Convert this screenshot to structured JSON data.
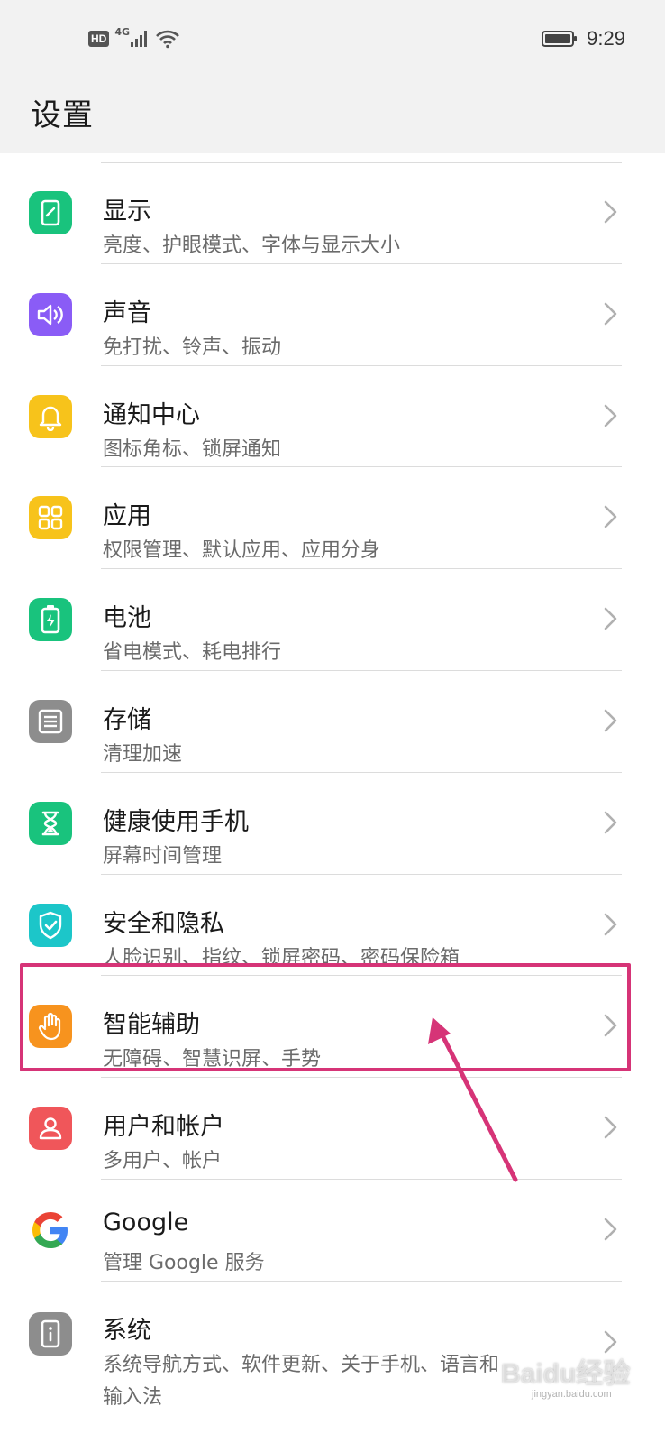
{
  "status_bar": {
    "hd_label": "HD",
    "network_label": "4G",
    "time": "9:29"
  },
  "header": {
    "title": "设置"
  },
  "settings": [
    {
      "title": "显示",
      "subtitle": "亮度、护眼模式、字体与显示大小",
      "icon": "display-icon",
      "color": "#19c37d"
    },
    {
      "title": "声音",
      "subtitle": "免打扰、铃声、振动",
      "icon": "speaker-icon",
      "color": "#8a5cf6"
    },
    {
      "title": "通知中心",
      "subtitle": "图标角标、锁屏通知",
      "icon": "bell-icon",
      "color": "#f7c31b"
    },
    {
      "title": "应用",
      "subtitle": "权限管理、默认应用、应用分身",
      "icon": "apps-grid-icon",
      "color": "#f7c31b"
    },
    {
      "title": "电池",
      "subtitle": "省电模式、耗电排行",
      "icon": "battery-icon",
      "color": "#19c37d"
    },
    {
      "title": "存储",
      "subtitle": "清理加速",
      "icon": "storage-icon",
      "color": "#8d8d8d"
    },
    {
      "title": "健康使用手机",
      "subtitle": "屏幕时间管理",
      "icon": "hourglass-icon",
      "color": "#19c37d"
    },
    {
      "title": "安全和隐私",
      "subtitle": "人脸识别、指纹、锁屏密码、密码保险箱",
      "icon": "shield-icon",
      "color": "#1cc6c9"
    },
    {
      "title": "智能辅助",
      "subtitle": "无障碍、智慧识屏、手势",
      "icon": "hand-icon",
      "color": "#f7931e"
    },
    {
      "title": "用户和帐户",
      "subtitle": "多用户、帐户",
      "icon": "user-icon",
      "color": "#f0565a"
    },
    {
      "title": "Google",
      "subtitle": "管理 Google 服务",
      "icon": "google-icon",
      "color": "#ffffff"
    },
    {
      "title": "系统",
      "subtitle": "系统导航方式、软件更新、关于手机、语言和",
      "subtitle2": "输入法",
      "icon": "system-info-icon",
      "color": "#8d8d8d"
    }
  ],
  "annotation": {
    "highlight_color": "#d63477",
    "highlighted_item": "智能辅助"
  },
  "watermark": {
    "text": "Baidu经验",
    "url": "jingyan.baidu.com"
  }
}
